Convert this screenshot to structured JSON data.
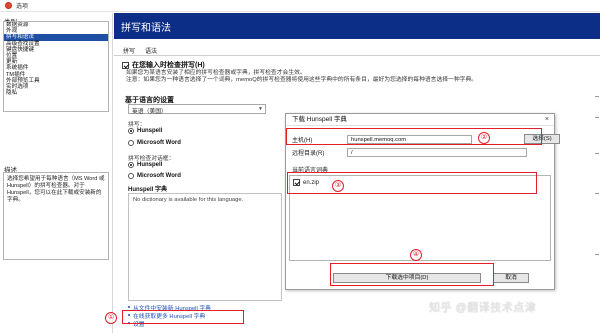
{
  "window": {
    "title": "选项"
  },
  "left": {
    "heading": "类别",
    "categories": [
      "数据资源",
      "外观",
      "拼写和语法",
      "高级查找设置",
      "键盘快捷键",
      "位置",
      "更新",
      "系统插件",
      "TM插件",
      "外部预览工具",
      "实时选项",
      "隐私"
    ],
    "selected_index": 2,
    "description_heading": "描述",
    "description": "选择您希望用于每种语言（MS Word 或 Hunspell）的拼写检查器。对于 Hunspell，您可以在此下载或安装新的字典。"
  },
  "header": {
    "title": "拼写和语法"
  },
  "tabs": [
    "拼写",
    "语法"
  ],
  "options": {
    "check_label": "在您输入时检查拼写(H)",
    "check_checked": true,
    "explain_1": "如果您为某语言安装了相应的拼写检查器或字典，拼写检查才会生效。",
    "explain_2": "注意：如果您为一种语言选择了一个词典，memoQ的拼写检查器将使用这些字典中的所有条目，最好为您选择的每种语言选择一种字典。",
    "section_title": "基于语言的设置",
    "language_value": "英语（美国）",
    "spell_check_label": "拼写：",
    "spell_options": [
      "Hunspell",
      "Microsoft Word"
    ],
    "grammar_label": "拼写检查对话框：",
    "grammar_options": [
      "Hunspell",
      "Microsoft Word"
    ],
    "hunspell_label": "Hunspell 字典",
    "no_dictionary_text": "No dictionary is available for this language.",
    "links": [
      "从文件中安装新 Hunspell 字典",
      "在线获取更多 Hunspell 字典",
      "设置"
    ]
  },
  "dialog": {
    "title": "下载 Hunspell 字典",
    "close_glyph": "×",
    "host_label": "主机(H)",
    "host_value": "hunspell.memoq.com",
    "select_button": "选择(S)",
    "remote_dir_label": "远程目录(R)",
    "remote_dir_value": "/",
    "available_label": "当前语言词典",
    "list_item": "en.zip",
    "download_button": "下载选中项目(D)",
    "cancel_button": "取消"
  },
  "annotations": [
    "①",
    "②",
    "③",
    "④"
  ],
  "watermark": "知乎 @翻译技术点津",
  "colors": {
    "header_bg": "#0c2e86",
    "selection": "#1f4fa5",
    "annotation_red": "#e51f2a",
    "link": "#1b4fb6"
  },
  "icons": {
    "app": "app-logo-icon",
    "dropdown": "chevron-down-icon",
    "close": "close-icon",
    "bullet": "bullet-icon"
  }
}
